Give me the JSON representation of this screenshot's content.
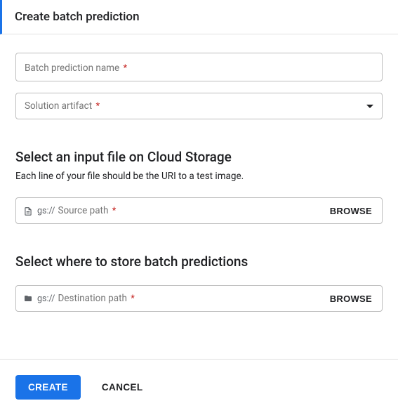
{
  "header": {
    "title": "Create batch prediction"
  },
  "fields": {
    "name": {
      "placeholder": "Batch prediction name",
      "required_mark": "*"
    },
    "artifact": {
      "placeholder": "Solution artifact",
      "required_mark": "*"
    }
  },
  "input_section": {
    "title": "Select an input file on Cloud Storage",
    "subtitle": "Each line of your file should be the URI to a test image.",
    "gs_prefix": "gs://",
    "placeholder": "Source path",
    "required_mark": "*",
    "browse_label": "BROWSE"
  },
  "output_section": {
    "title": "Select where to store batch predictions",
    "gs_prefix": "gs://",
    "placeholder": "Destination path",
    "required_mark": "*",
    "browse_label": "BROWSE"
  },
  "footer": {
    "create_label": "CREATE",
    "cancel_label": "CANCEL"
  }
}
